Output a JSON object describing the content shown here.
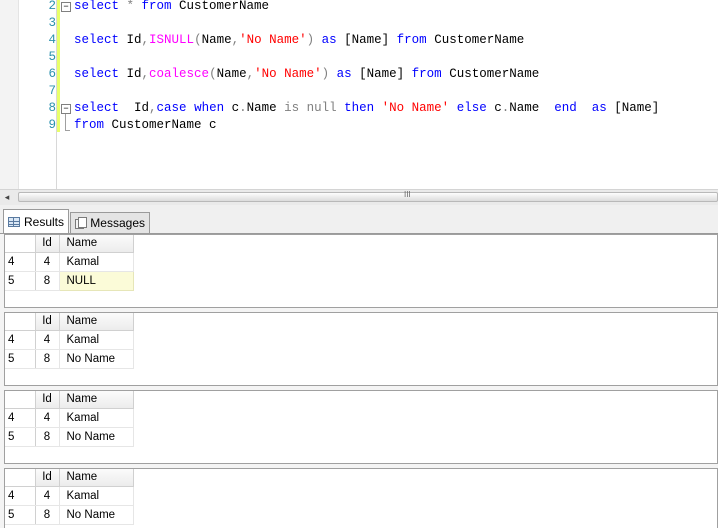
{
  "editor": {
    "lines": [
      {
        "num": "2",
        "tokens": [
          {
            "t": "select",
            "c": "kw"
          },
          {
            "t": " * ",
            "c": "gr"
          },
          {
            "t": "from",
            "c": "kw"
          },
          {
            "t": " CustomerName",
            "c": "ob"
          }
        ]
      },
      {
        "num": "3",
        "tokens": []
      },
      {
        "num": "4",
        "tokens": [
          {
            "t": "select",
            "c": "kw"
          },
          {
            "t": " Id",
            "c": "ob"
          },
          {
            "t": ",",
            "c": "gr"
          },
          {
            "t": "ISNULL",
            "c": "fn"
          },
          {
            "t": "(",
            "c": "gr"
          },
          {
            "t": "Name",
            "c": "ob"
          },
          {
            "t": ",",
            "c": "gr"
          },
          {
            "t": "'No Name'",
            "c": "str"
          },
          {
            "t": ")",
            "c": "gr"
          },
          {
            "t": " as ",
            "c": "kw"
          },
          {
            "t": "[Name]",
            "c": "ob"
          },
          {
            "t": " from",
            "c": "kw"
          },
          {
            "t": " CustomerName",
            "c": "ob"
          }
        ]
      },
      {
        "num": "5",
        "tokens": []
      },
      {
        "num": "6",
        "tokens": [
          {
            "t": "select",
            "c": "kw"
          },
          {
            "t": " Id",
            "c": "ob"
          },
          {
            "t": ",",
            "c": "gr"
          },
          {
            "t": "coalesce",
            "c": "fn"
          },
          {
            "t": "(",
            "c": "gr"
          },
          {
            "t": "Name",
            "c": "ob"
          },
          {
            "t": ",",
            "c": "gr"
          },
          {
            "t": "'No Name'",
            "c": "str"
          },
          {
            "t": ")",
            "c": "gr"
          },
          {
            "t": " as ",
            "c": "kw"
          },
          {
            "t": "[Name]",
            "c": "ob"
          },
          {
            "t": " from",
            "c": "kw"
          },
          {
            "t": " CustomerName",
            "c": "ob"
          }
        ]
      },
      {
        "num": "7",
        "tokens": []
      },
      {
        "num": "8",
        "tokens": [
          {
            "t": "select",
            "c": "kw"
          },
          {
            "t": "  Id",
            "c": "ob"
          },
          {
            "t": ",",
            "c": "gr"
          },
          {
            "t": "case",
            "c": "kw"
          },
          {
            "t": " when",
            "c": "kw"
          },
          {
            "t": " c",
            "c": "ob"
          },
          {
            "t": ".",
            "c": "gr"
          },
          {
            "t": "Name",
            "c": "ob"
          },
          {
            "t": " is",
            "c": "gr"
          },
          {
            "t": " null",
            "c": "gr"
          },
          {
            "t": " then",
            "c": "kw"
          },
          {
            "t": " 'No Name'",
            "c": "str"
          },
          {
            "t": " else",
            "c": "kw"
          },
          {
            "t": " c",
            "c": "ob"
          },
          {
            "t": ".",
            "c": "gr"
          },
          {
            "t": "Name",
            "c": "ob"
          },
          {
            "t": "  end",
            "c": "kw"
          },
          {
            "t": "  as",
            "c": "kw"
          },
          {
            "t": " [Name]",
            "c": "ob"
          }
        ]
      },
      {
        "num": "9",
        "tokens": [
          {
            "t": "from",
            "c": "kw"
          },
          {
            "t": " CustomerName c",
            "c": "ob"
          }
        ]
      }
    ]
  },
  "scrollbar": {
    "grip": "III"
  },
  "tabs": {
    "results": "Results",
    "messages": "Messages"
  },
  "result_grids": [
    {
      "headers": [
        "",
        "Id",
        "Name"
      ],
      "rows": [
        [
          "4",
          "4",
          "Kamal"
        ],
        [
          "5",
          "8",
          "NULL"
        ]
      ]
    },
    {
      "headers": [
        "",
        "Id",
        "Name"
      ],
      "rows": [
        [
          "4",
          "4",
          "Kamal"
        ],
        [
          "5",
          "8",
          "No Name"
        ]
      ]
    },
    {
      "headers": [
        "",
        "Id",
        "Name"
      ],
      "rows": [
        [
          "4",
          "4",
          "Kamal"
        ],
        [
          "5",
          "8",
          "No Name"
        ]
      ]
    },
    {
      "headers": [
        "",
        "Id",
        "Name"
      ],
      "rows": [
        [
          "4",
          "4",
          "Kamal"
        ],
        [
          "5",
          "8",
          "No Name"
        ]
      ]
    }
  ]
}
